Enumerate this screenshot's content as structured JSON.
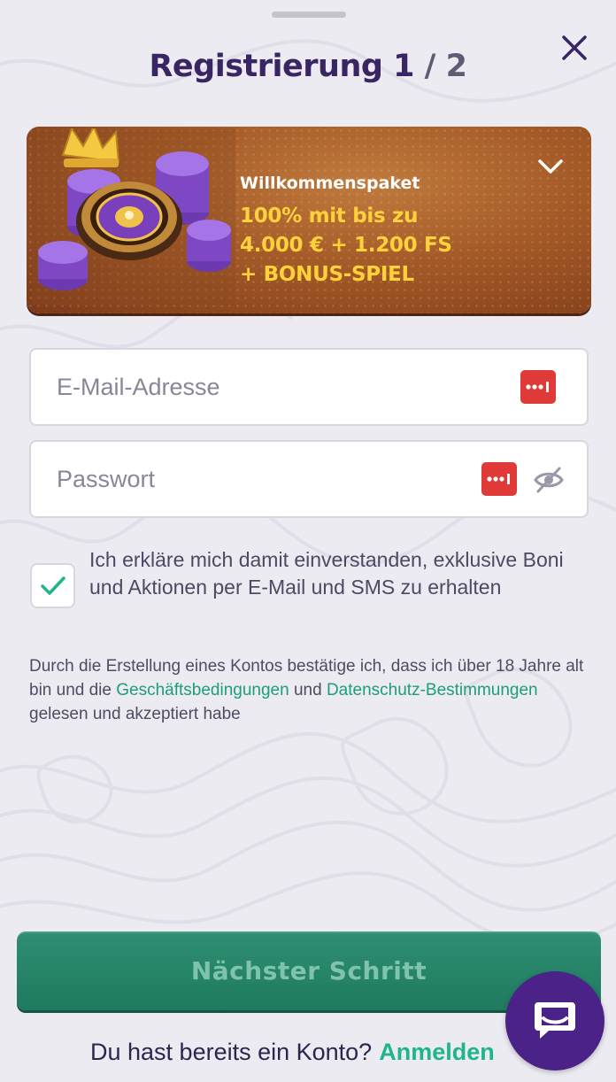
{
  "header": {
    "title_text": "Registrierung",
    "step_current": "1",
    "step_total": "/ 2"
  },
  "banner": {
    "label": "Willkommenspaket",
    "offer_line1": "100% mit bis zu",
    "offer_line2": "4.000 € + 1.200 FS",
    "offer_line3": "+ BONUS-SPIEL"
  },
  "form": {
    "email_placeholder": "E-Mail-Adresse",
    "email_value": "",
    "password_placeholder": "Passwort",
    "password_value": "",
    "consent_checked": true,
    "consent_text": "Ich erkläre mich damit einverstanden, exklusive Boni und Aktionen per E-Mail und SMS zu erhalten"
  },
  "legal": {
    "text_before": "Durch die Erstellung eines Kontos bestätige ich, dass ich über 18 Jahre alt bin und die ",
    "terms_link": "Geschäftsbedingungen",
    "text_middle": " und ",
    "privacy_link": "Datenschutz-Bestimmungen",
    "text_after": " gelesen und akzeptiert habe"
  },
  "footer": {
    "next_button": "Nächster Schritt",
    "login_prompt": "Du hast bereits ein Konto?",
    "login_link": "Anmelden"
  },
  "icons": {
    "close": "close-icon",
    "expand": "chevron-down-icon",
    "password_manager": "password-manager-icon",
    "toggle_visibility": "eye-off-icon",
    "check": "checkmark-icon",
    "chat": "chat-bubble-icon"
  },
  "colors": {
    "title": "#3a2563",
    "accent_green": "#1fb58b",
    "link_green": "#1c9e78",
    "button_green": "#2e8f73",
    "offer_yellow": "#ffd23b",
    "chat_purple": "#4b2288",
    "key_red": "#df3a37"
  }
}
